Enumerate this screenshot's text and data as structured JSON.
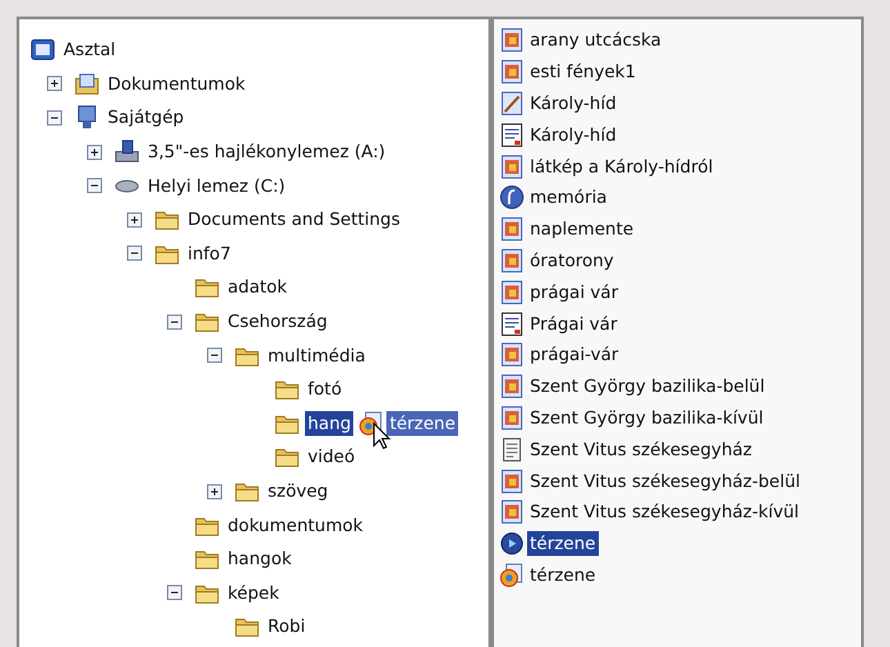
{
  "tree": {
    "label": "Asztal",
    "kind": "desktop",
    "children": [
      {
        "label": "Dokumentumok",
        "kind": "documents",
        "expanded": false
      },
      {
        "label": "Sajátgép",
        "kind": "computer",
        "expanded": true,
        "children": [
          {
            "label": "3,5\"-es hajlékonylemez (A:)",
            "kind": "floppy",
            "expanded": false
          },
          {
            "label": "Helyi lemez (C:)",
            "kind": "drive",
            "expanded": true,
            "children": [
              {
                "label": "Documents and Settings",
                "kind": "folder",
                "expanded": false
              },
              {
                "label": "info7",
                "kind": "folder",
                "expanded": true,
                "children": [
                  {
                    "label": "adatok",
                    "kind": "folder"
                  },
                  {
                    "label": "Csehország",
                    "kind": "folder",
                    "expanded": true,
                    "children": [
                      {
                        "label": "multimédia",
                        "kind": "folder",
                        "expanded": true,
                        "children": [
                          {
                            "label": "fotó",
                            "kind": "folder",
                            "selected": false
                          },
                          {
                            "label": "hang",
                            "kind": "folder",
                            "selected": true,
                            "drop_item": {
                              "label": "térzene",
                              "kind": "media"
                            }
                          },
                          {
                            "label": "videó",
                            "kind": "folder",
                            "selected": false
                          }
                        ]
                      },
                      {
                        "label": "szöveg",
                        "kind": "folder",
                        "expanded": false
                      }
                    ]
                  },
                  {
                    "label": "dokumentumok",
                    "kind": "folder"
                  },
                  {
                    "label": "hangok",
                    "kind": "folder"
                  },
                  {
                    "label": "képek",
                    "kind": "folder",
                    "expanded": true,
                    "children": [
                      {
                        "label": "Robi",
                        "kind": "folder"
                      }
                    ]
                  }
                ]
              }
            ]
          }
        ]
      }
    ]
  },
  "files": [
    {
      "label": "arany utcácska",
      "kind": "image",
      "selected": false
    },
    {
      "label": "esti fények1",
      "kind": "image",
      "selected": false
    },
    {
      "label": "Károly-híd",
      "kind": "paint",
      "selected": false
    },
    {
      "label": "Károly-híd",
      "kind": "document",
      "selected": false
    },
    {
      "label": "látkép a Károly-hídról",
      "kind": "image",
      "selected": false
    },
    {
      "label": "memória",
      "kind": "flash",
      "selected": false
    },
    {
      "label": "naplemente",
      "kind": "image",
      "selected": false
    },
    {
      "label": "óratorony",
      "kind": "image",
      "selected": false
    },
    {
      "label": "prágai vár",
      "kind": "image",
      "selected": false
    },
    {
      "label": "Prágai vár",
      "kind": "document",
      "selected": false
    },
    {
      "label": "prágai-vár",
      "kind": "image",
      "selected": false
    },
    {
      "label": "Szent György bazilika-belül",
      "kind": "image",
      "selected": false
    },
    {
      "label": "Szent György bazilika-kívül",
      "kind": "image",
      "selected": false
    },
    {
      "label": "Szent Vitus székesegyház",
      "kind": "text",
      "selected": false
    },
    {
      "label": "Szent Vitus székesegyház-belül",
      "kind": "image",
      "selected": false
    },
    {
      "label": "Szent Vitus székesegyház-kívül",
      "kind": "image",
      "selected": false
    },
    {
      "label": "térzene",
      "kind": "audio",
      "selected": true
    },
    {
      "label": "térzene",
      "kind": "media",
      "selected": false
    }
  ]
}
